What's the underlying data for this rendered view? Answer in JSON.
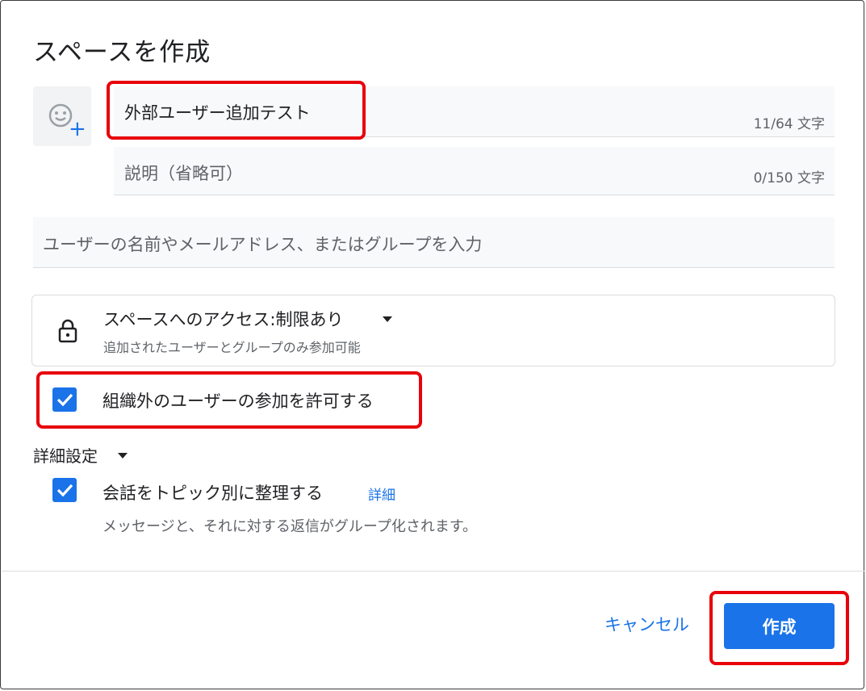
{
  "dialog": {
    "title": "スペースを作成"
  },
  "space_name": {
    "value": "外部ユーザー追加テスト",
    "counter": "11/64 文字"
  },
  "description": {
    "placeholder": "説明（省略可）",
    "counter": "0/150 文字"
  },
  "people_input": {
    "placeholder": "ユーザーの名前やメールアドレス、またはグループを入力"
  },
  "access": {
    "title": "スペースへのアクセス:制限あり",
    "subtitle": "追加されたユーザーとグループのみ参加可能"
  },
  "external_users": {
    "label": "組織外のユーザーの参加を許可する",
    "checked": true
  },
  "advanced": {
    "title": "詳細設定",
    "topic_label": "会話をトピック別に整理する",
    "topic_link": "詳細",
    "topic_checked": true,
    "topic_description": "メッセージと、それに対する返信がグループ化されます。"
  },
  "footer": {
    "cancel_label": "キャンセル",
    "create_label": "作成"
  },
  "colors": {
    "accent": "#1a73e8",
    "highlight": "#e8000b"
  }
}
